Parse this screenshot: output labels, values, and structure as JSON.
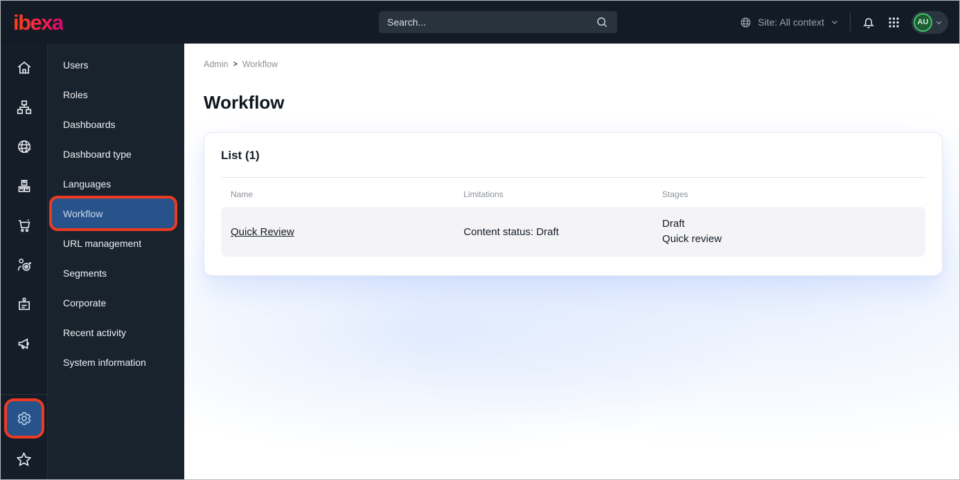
{
  "topbar": {
    "logo_text": "ibexa",
    "search_placeholder": "Search...",
    "site_context_label": "Site: All context",
    "avatar_initials": "AU"
  },
  "rail_icons": [
    "home-icon",
    "sitemap-icon",
    "globe-cursor-icon",
    "boxes-icon",
    "cart-icon",
    "target-user-icon",
    "badge-icon",
    "megaphone-icon",
    "gear-icon",
    "star-icon"
  ],
  "sidebar": {
    "items": [
      {
        "label": "Users",
        "selected": false
      },
      {
        "label": "Roles",
        "selected": false
      },
      {
        "label": "Dashboards",
        "selected": false
      },
      {
        "label": "Dashboard type",
        "selected": false
      },
      {
        "label": "Languages",
        "selected": false
      },
      {
        "label": "Workflow",
        "selected": true
      },
      {
        "label": "URL management",
        "selected": false
      },
      {
        "label": "Segments",
        "selected": false
      },
      {
        "label": "Corporate",
        "selected": false
      },
      {
        "label": "Recent activity",
        "selected": false
      },
      {
        "label": "System information",
        "selected": false
      }
    ]
  },
  "breadcrumb": {
    "items": [
      "Admin",
      "Workflow"
    ],
    "separator": ">"
  },
  "page": {
    "title": "Workflow"
  },
  "list": {
    "heading": "List (1)",
    "columns": [
      "Name",
      "Limitations",
      "Stages"
    ],
    "rows": [
      {
        "name": "Quick Review",
        "limitations": "Content status: Draft",
        "stages": [
          "Draft",
          "Quick review"
        ]
      }
    ]
  },
  "colors": {
    "topbar_bg": "#131c26",
    "selected_blue": "#27538a",
    "highlight_border": "#ee3a21",
    "avatar_ring_green": "#40c568",
    "logo_gradient_start": "#ff4113",
    "logo_gradient_end": "#d6056f"
  }
}
